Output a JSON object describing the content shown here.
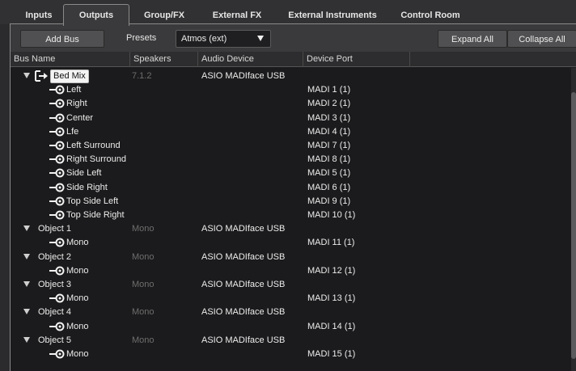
{
  "tabs": [
    {
      "label": "Inputs",
      "active": false
    },
    {
      "label": "Outputs",
      "active": true
    },
    {
      "label": "Group/FX",
      "active": false
    },
    {
      "label": "External FX",
      "active": false
    },
    {
      "label": "External Instruments",
      "active": false
    },
    {
      "label": "Control Room",
      "active": false
    }
  ],
  "toolbar": {
    "add_bus": "Add Bus",
    "presets_label": "Presets",
    "preset_value": "Atmos (ext)",
    "expand_all": "Expand All",
    "collapse_all": "Collapse All"
  },
  "columns": [
    "Bus Name",
    "Speakers",
    "Audio Device",
    "Device Port"
  ],
  "rows": [
    {
      "kind": "bus",
      "name": "Bed Mix",
      "speakers": "7.1.2",
      "device": "ASIO MADIface USB",
      "port": "",
      "selected": true
    },
    {
      "kind": "channel",
      "name": "Left",
      "port": "MADI 1 (1)"
    },
    {
      "kind": "channel",
      "name": "Right",
      "port": "MADI 2 (1)"
    },
    {
      "kind": "channel",
      "name": "Center",
      "port": "MADI 3 (1)"
    },
    {
      "kind": "channel",
      "name": "Lfe",
      "port": "MADI 4 (1)"
    },
    {
      "kind": "channel",
      "name": "Left Surround",
      "port": "MADI 7 (1)"
    },
    {
      "kind": "channel",
      "name": "Right Surround",
      "port": "MADI 8 (1)"
    },
    {
      "kind": "channel",
      "name": "Side Left",
      "port": "MADI 5 (1)"
    },
    {
      "kind": "channel",
      "name": "Side Right",
      "port": "MADI 6 (1)"
    },
    {
      "kind": "channel",
      "name": "Top Side Left",
      "port": "MADI 9 (1)"
    },
    {
      "kind": "channel",
      "name": "Top Side Right",
      "port": "MADI 10 (1)"
    },
    {
      "kind": "object",
      "name": "Object 1",
      "speakers": "Mono",
      "device": "ASIO MADIface USB",
      "port": ""
    },
    {
      "kind": "channel",
      "name": "Mono",
      "port": "MADI 11 (1)"
    },
    {
      "kind": "object",
      "name": "Object 2",
      "speakers": "Mono",
      "device": "ASIO MADIface USB",
      "port": ""
    },
    {
      "kind": "channel",
      "name": "Mono",
      "port": "MADI 12 (1)"
    },
    {
      "kind": "object",
      "name": "Object 3",
      "speakers": "Mono",
      "device": "ASIO MADIface USB",
      "port": ""
    },
    {
      "kind": "channel",
      "name": "Mono",
      "port": "MADI 13 (1)"
    },
    {
      "kind": "object",
      "name": "Object 4",
      "speakers": "Mono",
      "device": "ASIO MADIface USB",
      "port": ""
    },
    {
      "kind": "channel",
      "name": "Mono",
      "port": "MADI 14 (1)"
    },
    {
      "kind": "object",
      "name": "Object 5",
      "speakers": "Mono",
      "device": "ASIO MADIface USB",
      "port": ""
    },
    {
      "kind": "channel",
      "name": "Mono",
      "port": "MADI 15 (1)"
    }
  ],
  "icons": {
    "bus": "output-bus-icon",
    "channel": "output-channel-icon",
    "expand": "chevron-down-icon",
    "dropdown": "dropdown-arrow-icon"
  },
  "colors": {
    "background": "#2b2b2d",
    "panel": "#3a3a3c",
    "list": "#1b1b1d",
    "text": "#ececec",
    "speakers_text": "#6e6e6e",
    "selected_bg": "#f4f4f4"
  }
}
